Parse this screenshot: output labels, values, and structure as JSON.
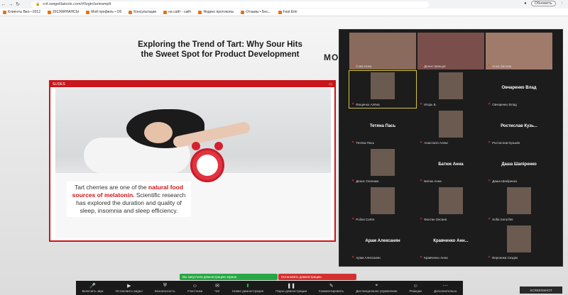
{
  "browser": {
    "url": "cnf.swigeillatools.com/#/login/seleamplt",
    "update_label": "Обновить",
    "bookmarks": [
      "Клиенты Виз—2012",
      "2012ФИНАНСЫ",
      "Мой профиль • Об",
      "Консультации",
      "на сайт - сайт",
      "Яндекс протоколы",
      "Отзывы • Бес...",
      "Fast Emi"
    ]
  },
  "slide": {
    "headline_line1": "Exploring the Trend of Tart: Why Sour Hits",
    "headline_line2": "the Sweet Spot for Product Development",
    "brand_partial": "MO",
    "window_title": "SLIDES",
    "caption_pre": "Tart cherries are one of the ",
    "caption_bold": "natural food sources of melatonin.",
    "caption_post": " Scientific research has explored the duration and quality of sleep, insomnia and sleep efficiency."
  },
  "participants": [
    {
      "name": "",
      "label": "Сова Ника",
      "video": true
    },
    {
      "name": "",
      "label": "Денис Швецов",
      "video": true
    },
    {
      "name": "",
      "label": "Анна Зилова",
      "video": true
    },
    {
      "name": "",
      "label": "Фощенко Алёна",
      "video": true,
      "highlight": true
    },
    {
      "name": "",
      "label": "Игорь Б.",
      "video": true
    },
    {
      "name": "Овчаренко Влад",
      "label": "Овчаренко Влад",
      "video": false
    },
    {
      "name": "Тетяна Пась",
      "label": "Тетяна Пась",
      "video": false
    },
    {
      "name": "",
      "label": "Анастасія Алекс",
      "video": true
    },
    {
      "name": "Ростислав Кузь...",
      "label": "Ростислав Кузьмін",
      "video": false
    },
    {
      "name": "",
      "label": "Денис Оксенюк",
      "video": true
    },
    {
      "name": "Батюк Анна",
      "label": "Батюк Анна",
      "video": false
    },
    {
      "name": "Даша Шапіренко",
      "label": "Даша Шапіренко",
      "video": false
    },
    {
      "name": "",
      "label": "Polina Cartre",
      "video": true
    },
    {
      "name": "",
      "label": "Фонтан Оксана",
      "video": true
    },
    {
      "name": "",
      "label": "Sofia Sorochts",
      "video": true
    },
    {
      "name": "Арам Алексанян",
      "label": "Арам Алексанян",
      "video": false
    },
    {
      "name": "Кравченко Анн...",
      "label": "Кравченко Анна",
      "video": false
    },
    {
      "name": "",
      "label": "Вероника Сездяк",
      "video": true
    }
  ],
  "notices": {
    "green": "Вы запустили демонстрацию экрана",
    "red": "Остановить демонстрацию"
  },
  "toolbar": [
    {
      "icon": "mic-icon",
      "label": "Включить звук"
    },
    {
      "icon": "video-icon",
      "label": "Остановить видео"
    },
    {
      "icon": "security-icon",
      "label": "Безопасность"
    },
    {
      "icon": "participants-icon",
      "label": "Участники"
    },
    {
      "icon": "chat-icon",
      "label": "Чат"
    },
    {
      "icon": "share-icon",
      "label": "Новая демонстрация"
    },
    {
      "icon": "pause-icon",
      "label": "Пауза демонстрации"
    },
    {
      "icon": "annotate-icon",
      "label": "Комментировать"
    },
    {
      "icon": "remote-icon",
      "label": "Дистанционное управление"
    },
    {
      "icon": "reactions-icon",
      "label": "Реакции"
    },
    {
      "icon": "more-icon",
      "label": "Дополнительно"
    }
  ],
  "my_work": "SCREENSHOT"
}
